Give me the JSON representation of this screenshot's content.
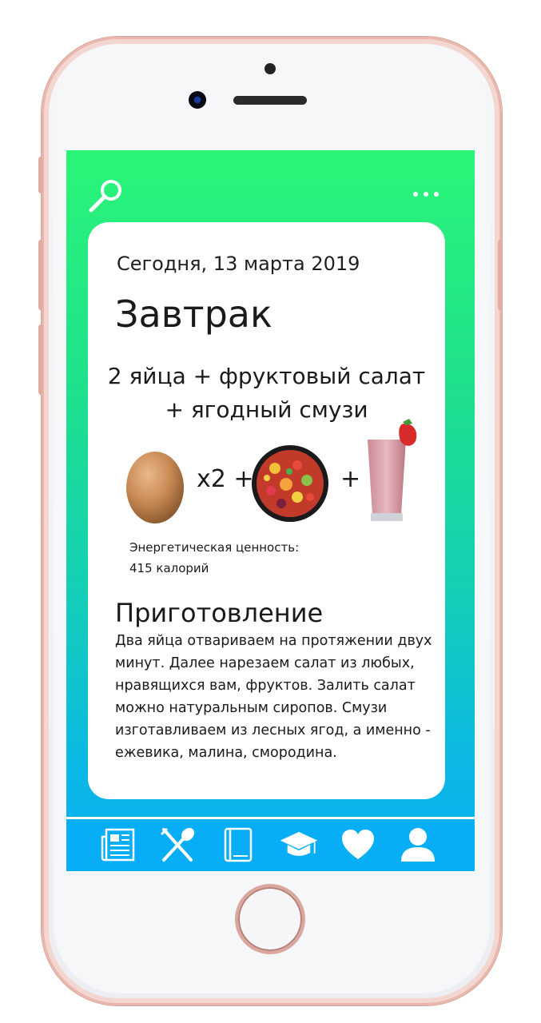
{
  "header": {
    "search_icon": "search-icon",
    "menu_icon": "more-dots-icon"
  },
  "meal": {
    "date": "Сегодня, 13 марта 2019",
    "title": "Завтрак",
    "description": "2 яйца + фруктовый салат + ягодный смузи",
    "items": [
      {
        "name": "egg",
        "icon": "egg-icon"
      },
      {
        "operator": "x2 +"
      },
      {
        "name": "fruit-salad",
        "icon": "fruit-salad-icon"
      },
      {
        "operator": "+"
      },
      {
        "name": "berry-smoothie",
        "icon": "smoothie-icon"
      }
    ],
    "operator_1": "x2 +",
    "operator_2": "+",
    "energy_label": "Энергетическая ценность:",
    "energy_value": "415 калорий"
  },
  "preparation": {
    "title": "Приготовление",
    "text": "Два яйца отвариваем на протяжении двух минут. Далее нарезаем салат из любых, нравящихся вам, фруктов. Залить салат можно натуральным сиропов. Смузи изготавливаем из лесных ягод, а именно - ежевика, малина, смородина."
  },
  "tabbar": {
    "items": [
      {
        "icon": "newspaper-icon"
      },
      {
        "icon": "fork-spoon-icon"
      },
      {
        "icon": "book-icon"
      },
      {
        "icon": "graduation-cap-icon"
      },
      {
        "icon": "heart-icon"
      },
      {
        "icon": "user-icon"
      }
    ]
  },
  "colors": {
    "gradient_top": "#2bf577",
    "gradient_bottom": "#07aef6",
    "tabbar": "#07aef6",
    "card": "#ffffff",
    "phone_frame": "#e8b6ad"
  }
}
